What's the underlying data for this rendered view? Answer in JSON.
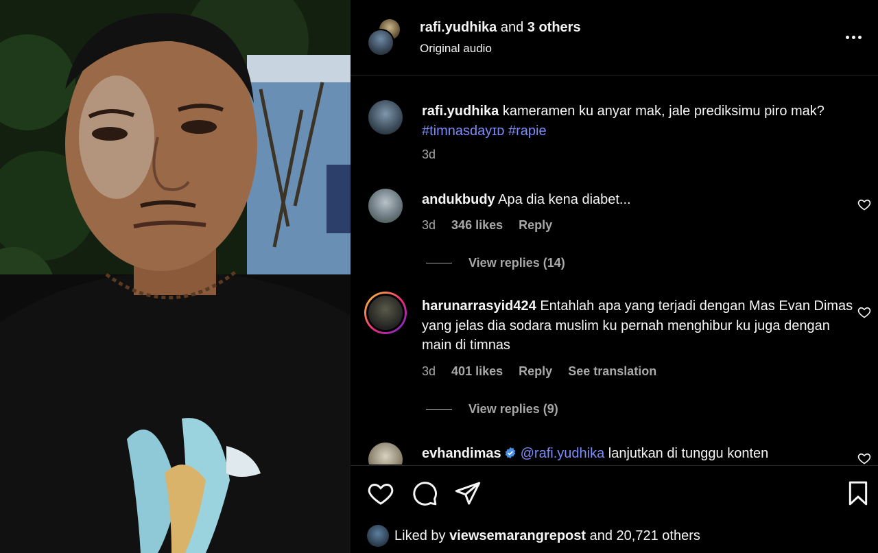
{
  "header": {
    "username": "rafi.yudhika",
    "and_text": "and",
    "others": "3 others",
    "audio": "Original audio"
  },
  "caption": {
    "username": "rafi.yudhika",
    "text": "kameramen ku anyar mak, jale prediksimu piro mak?",
    "hashtag1": "#timnasdayɪᴅ",
    "hashtag2": "#rapie",
    "time": "3d"
  },
  "comments": [
    {
      "username": "andukbudy",
      "text": "Apa dia kena diabet...",
      "time": "3d",
      "likes": "346 likes",
      "reply": "Reply",
      "view_replies": "View replies (14)"
    },
    {
      "username": "harunarrasyid424",
      "text": "Entahlah apa yang terjadi dengan Mas Evan Dimas yang jelas dia sodara muslim ku pernah menghibur ku juga dengan main di timnas",
      "time": "3d",
      "likes": "401 likes",
      "reply": "Reply",
      "translation": "See translation",
      "view_replies": "View replies (9)"
    },
    {
      "username": "evhandimas",
      "mention": "@rafi.yudhika",
      "text": "lanjutkan di tunggu konten"
    }
  ],
  "likes": {
    "prefix": "Liked by",
    "username": "viewsemarangrepost",
    "suffix": "and 20,721 others"
  },
  "icons": {
    "like": "heart-icon",
    "comment": "comment-icon",
    "share": "paper-plane-icon",
    "save": "bookmark-icon",
    "more": "more-horizontal-icon",
    "verified": "verified-badge-icon"
  },
  "colors": {
    "background": "#000000",
    "text": "#f5f5f5",
    "secondary": "#a8a8a8",
    "link": "#7c8cf8",
    "verified": "#4a90e2"
  }
}
